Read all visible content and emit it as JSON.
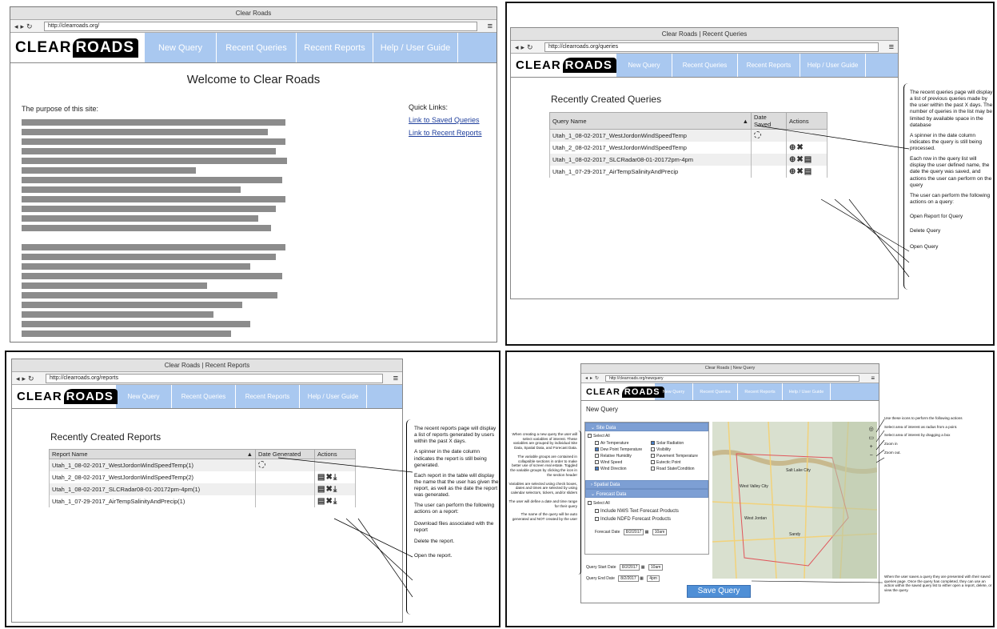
{
  "q1": {
    "window_title": "Clear Roads",
    "url": "http://clearroads.org/",
    "logo_left": "CLEAR",
    "logo_right": "ROADS",
    "nav": [
      "New Query",
      "Recent Queries",
      "Recent Reports",
      "Help / User Guide"
    ],
    "heading": "Welcome to Clear Roads",
    "purpose_label": "The purpose of this site:",
    "quick_links_label": "Quick Links:",
    "link_saved": "Link to Saved Queries",
    "link_reports": "Link to Recent Reports"
  },
  "q2": {
    "window_title": "Clear Roads | Recent Queries",
    "url": "http://clearroads.org/queries",
    "heading": "Recently Created Queries",
    "columns": [
      "Query Name",
      "Date Saved",
      "Actions"
    ],
    "rows": [
      {
        "name": "Utah_1_08-02-2017_WestJordonWindSpeedTemp"
      },
      {
        "name": "Utah_2_08-02-2017_WestJordonWindSpeedTemp"
      },
      {
        "name": "Utah_1_08-02-2017_SLCRadar08-01-20172pm-4pm"
      },
      {
        "name": "Utah_1_07-29-2017_AirTempSalinityAndPrecip"
      }
    ],
    "annotations": [
      "The recent queries page will display a list of previous queries made by the user within the past X days. The number of queries in the list may be limited by available space in the database",
      "A spinner in the date column indicates the query is still being processed.",
      "Each row in the query list will display the user defined name, the date the query was saved, and actions the user can perform on the query",
      "The user can perform the following actions on a query:",
      "Open Report for Query",
      "Delete Query",
      "Open Query"
    ]
  },
  "q3": {
    "window_title": "Clear Roads | Recent Reports",
    "url": "http://clearroads.org/reports",
    "heading": "Recently Created Reports",
    "columns": [
      "Report Name",
      "Date Generated",
      "Actions"
    ],
    "rows": [
      {
        "name": "Utah_1_08-02-2017_WestJordonWindSpeedTemp(1)"
      },
      {
        "name": "Utah_2_08-02-2017_WestJordonWindSpeedTemp(2)"
      },
      {
        "name": "Utah_1_08-02-2017_SLCRadar08-01-20172pm-4pm(1)"
      },
      {
        "name": "Utah_1_07-29-2017_AirTempSalinityAndPrecip(1)"
      }
    ],
    "annotations": [
      "The recent reports page will display a list of reports generated by users within the past X days.",
      "A spinner in the date column indicates the report is still being generated.",
      "Each report in the table will display the name that the user has given the report, as well as the date the report was generated.",
      "The user can perform the following actions on a report:",
      "Download files associated with the report",
      "Delete the report.",
      "Open the report."
    ]
  },
  "q4": {
    "window_title": "Clear Roads | New Query",
    "url": "http://clearroads.org/newquery",
    "heading": "New Query",
    "site_data": "Site Data",
    "select_all": "Select All",
    "variables_left": [
      "Air Temperature",
      "Dew Point Temperature",
      "Relative Humidity",
      "Wind Speed",
      "Wind Direction"
    ],
    "variables_right": [
      "Solar Radiation",
      "Visibility",
      "Pavement Temperature",
      "Eutectic Point",
      "Road State/Condition"
    ],
    "spatial_data": "Spatial Data",
    "forecast_data": "Forecast Data",
    "include_nws": "Include NWS Text Forecast Products",
    "include_ndfd": "Include NDFD Forecast Products",
    "forecast_date_label": "Forecast Date",
    "forecast_date": "8/2/2017",
    "forecast_time": "10am",
    "start_label": "Query Start Date",
    "start_date": "8/2/2017",
    "start_time": "10am",
    "end_label": "Query End Date",
    "end_date": "8/2/2017",
    "end_time": "4pm",
    "save_button": "Save Query",
    "map_labels": [
      "Salt Lake City",
      "West Valley City",
      "Sandy",
      "West Jordan"
    ],
    "left_notes": [
      "When creating a new query the user will select variables of interest. These variables are grouped by individual Site Data, Spatial Data, and Forecast Data.",
      "The variable groups are contained in collapsible sections in order to make better use of screen real estate. Toggled the variable groups by clicking the icon in the section header",
      "Variables are selected using check boxes, dates and times are selected by using calendar selectors, tickers, and/or sliders",
      "The user will define a date and time range for their query",
      "The name of the query will be auto generated and NOT created by the user"
    ],
    "right_notes": [
      "Use these icons to perform the following actions",
      "Select area of interest as radius from a point.",
      "Select area of interest by dragging a box",
      "Zoom in",
      "Zoom out."
    ],
    "save_note": "When the user saves a query they are presented with their saved queries page. Once the query has completed, they can use an action within the saved query list to either open a report, delete, or view the query."
  }
}
